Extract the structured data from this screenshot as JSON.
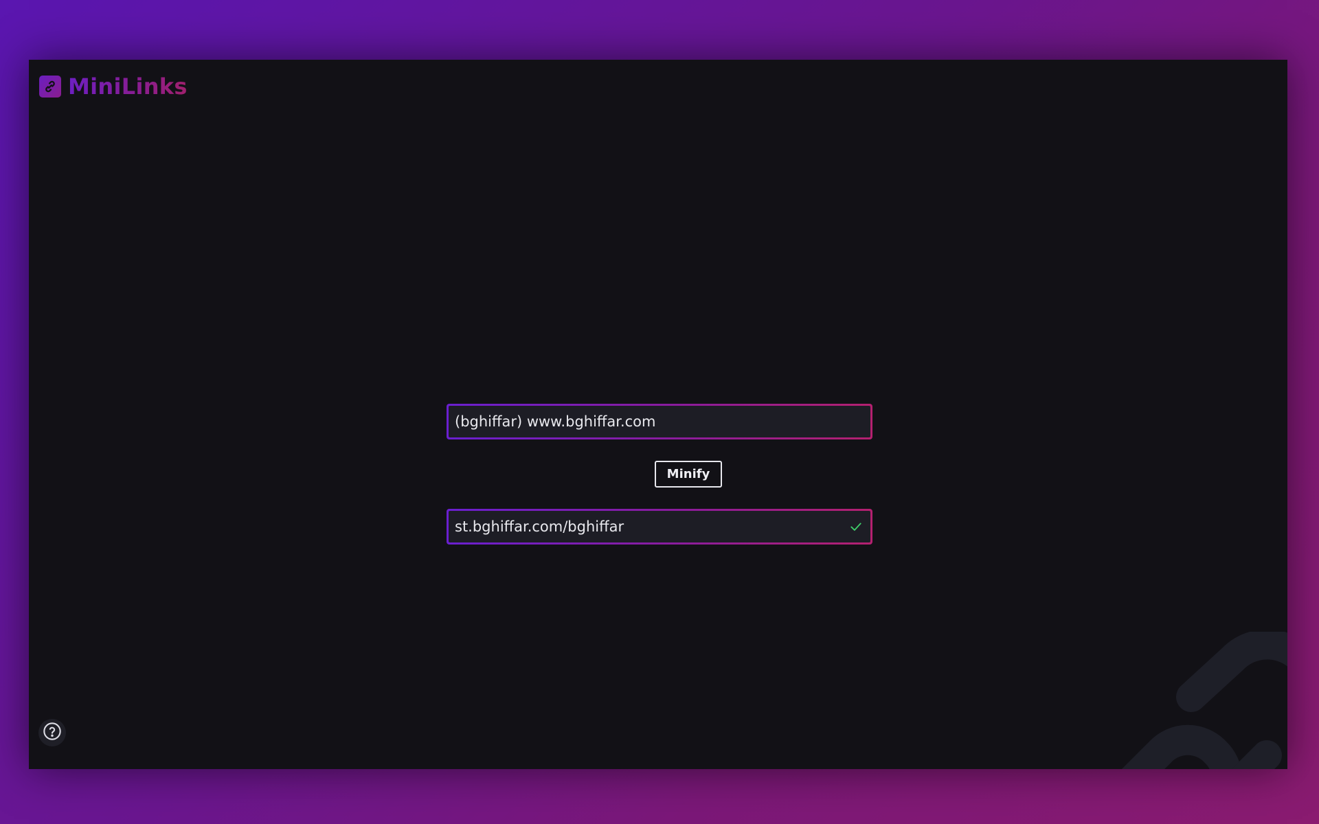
{
  "app": {
    "name": "MiniLinks",
    "icon": "link-icon"
  },
  "form": {
    "url_input": {
      "value": "(bghiffar) www.bghiffar.com",
      "placeholder": ""
    },
    "minify_label": "Minify",
    "result_input": {
      "value": "st.bghiffar.com/bghiffar",
      "status_icon": "check-icon"
    }
  },
  "help": {
    "icon": "question-circle-icon"
  },
  "decoration": {
    "icon": "link-watermark-icon"
  },
  "colors": {
    "accent_start": "#6a1fd0",
    "accent_end": "#b4206f",
    "panel_bg": "#121116",
    "field_bg": "#1d1d25",
    "success": "#3ecf6a"
  }
}
